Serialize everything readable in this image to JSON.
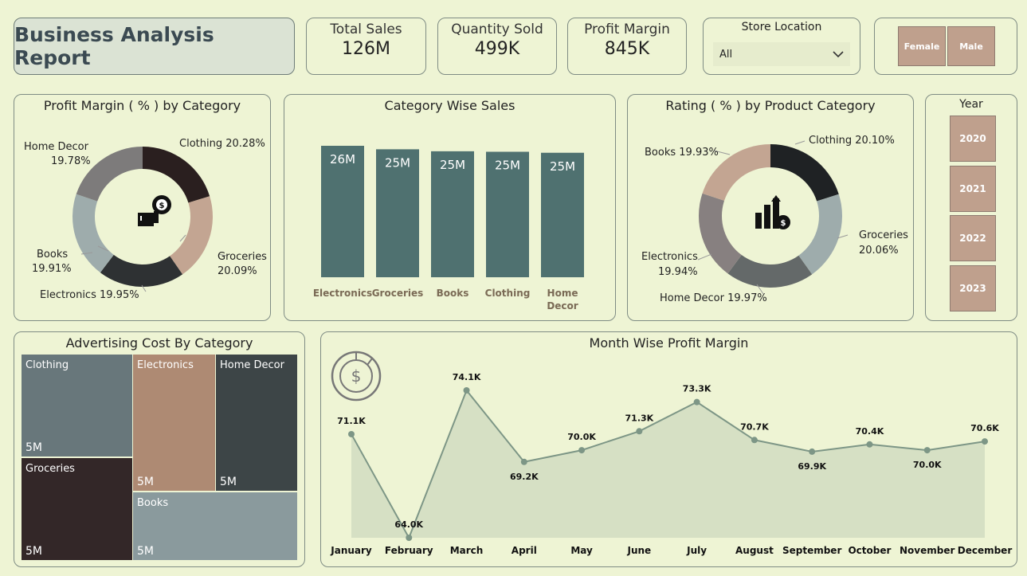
{
  "header": {
    "title": "Business Analysis Report",
    "kpis": [
      {
        "label": "Total Sales",
        "value": "126M"
      },
      {
        "label": "Quantity Sold",
        "value": "499K"
      },
      {
        "label": "Profit Margin",
        "value": "845K"
      }
    ],
    "store": {
      "label": "Store Location",
      "selected": "All"
    },
    "gender": [
      "Female",
      "Male"
    ]
  },
  "years": {
    "title": "Year",
    "options": [
      "2020",
      "2021",
      "2022",
      "2023"
    ]
  },
  "colors": {
    "background": "#eef4d4",
    "bar": "#4f7170",
    "slicer": "#bfa08d",
    "area": "#d6e0c4",
    "line": "#7d9686"
  },
  "chart_data": [
    {
      "type": "pie",
      "title": "Profit Margin ( % ) by Category",
      "donut": true,
      "center_icon": "gear-dollar-box-icon",
      "slices": [
        {
          "label": "Clothing",
          "value": 20.28,
          "text": "20.28%",
          "color": "#2a1f1f"
        },
        {
          "label": "Groceries",
          "value": 20.09,
          "text": "20.09%",
          "color": "#c3a592"
        },
        {
          "label": "Electronics",
          "value": 19.95,
          "text": "19.95%",
          "color": "#2e3133"
        },
        {
          "label": "Books",
          "value": 19.91,
          "text": "19.91%",
          "color": "#9eacac"
        },
        {
          "label": "Home Decor",
          "value": 19.78,
          "text": "19.78%",
          "color": "#7d7b7b"
        }
      ]
    },
    {
      "type": "bar",
      "title": "Category Wise Sales",
      "categories": [
        "Electronics",
        "Groceries",
        "Books",
        "Clothing",
        "Home Decor"
      ],
      "values": [
        26,
        25,
        25,
        25,
        25
      ],
      "value_labels": [
        "26M",
        "25M",
        "25M",
        "25M",
        "25M"
      ],
      "heights": [
        26.4,
        25.7,
        25.3,
        25.2,
        25.0
      ]
    },
    {
      "type": "pie",
      "title": "Rating ( % ) by Product Category",
      "donut": true,
      "center_icon": "growth-dollar-icon",
      "slices": [
        {
          "label": "Clothing",
          "value": 20.1,
          "text": "20.10%",
          "color": "#1f2224"
        },
        {
          "label": "Groceries",
          "value": 20.06,
          "text": "20.06%",
          "color": "#9eacac"
        },
        {
          "label": "Home Decor",
          "value": 19.97,
          "text": "19.97%",
          "color": "#646969"
        },
        {
          "label": "Electronics",
          "value": 19.94,
          "text": "19.94%",
          "color": "#878080"
        },
        {
          "label": "Books",
          "value": 19.93,
          "text": "19.93%",
          "color": "#c3a592"
        }
      ]
    },
    {
      "type": "treemap",
      "title": "Advertising Cost By Category",
      "items": [
        {
          "label": "Clothing",
          "value": "5M",
          "color": "#68777b"
        },
        {
          "label": "Electronics",
          "value": "5M",
          "color": "#ae8a73"
        },
        {
          "label": "Home Decor",
          "value": "5M",
          "color": "#3d4547"
        },
        {
          "label": "Groceries",
          "value": "5M",
          "color": "#332728"
        },
        {
          "label": "Books",
          "value": "5M",
          "color": "#8a9a9d"
        }
      ]
    },
    {
      "type": "area",
      "title": "Month Wise Profit Margin",
      "icon": "dollar-chart-icon",
      "x": [
        "January",
        "February",
        "March",
        "April",
        "May",
        "June",
        "July",
        "August",
        "September",
        "October",
        "November",
        "December"
      ],
      "values": [
        71.1,
        64.0,
        74.1,
        69.2,
        70.0,
        71.3,
        73.3,
        70.7,
        69.9,
        70.4,
        70.0,
        70.6
      ],
      "value_labels": [
        "71.1K",
        "64.0K",
        "74.1K",
        "69.2K",
        "70.0K",
        "71.3K",
        "73.3K",
        "70.7K",
        "69.9K",
        "70.4K",
        "70.0K",
        "70.6K"
      ],
      "ylim": [
        64.0,
        74.1
      ]
    }
  ]
}
